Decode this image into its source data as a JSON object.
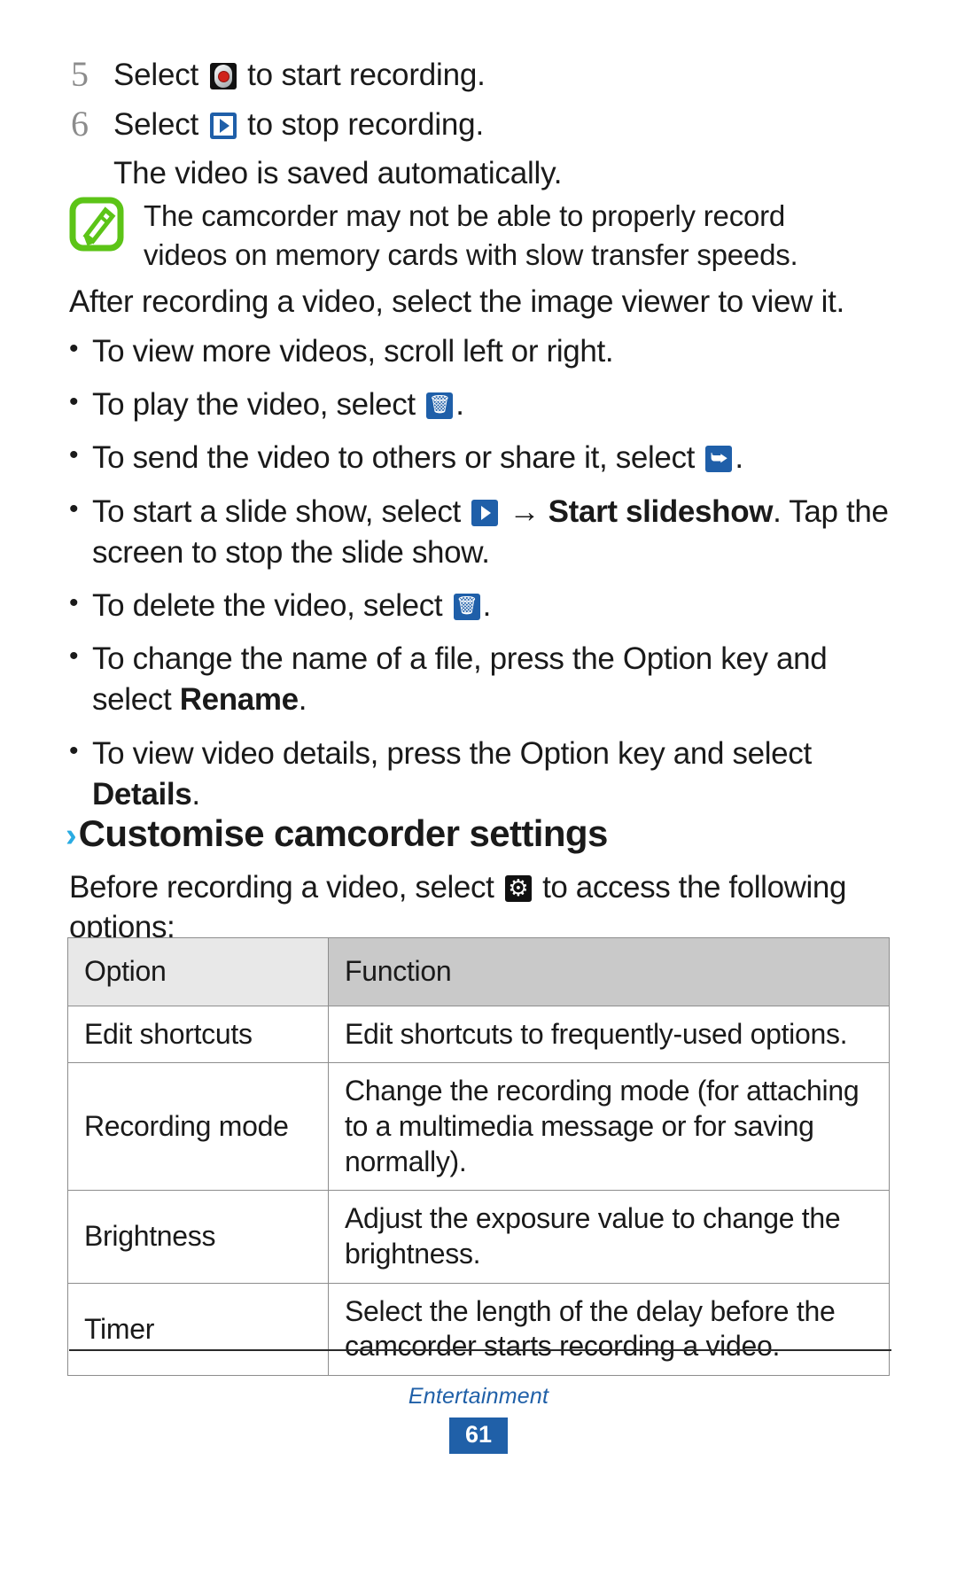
{
  "steps": [
    {
      "number": "5",
      "pre": "Select ",
      "icon": "record-icon",
      "post": " to start recording.",
      "sub": ""
    },
    {
      "number": "6",
      "pre": "Select ",
      "icon": "stop-play-icon",
      "post": " to stop recording.",
      "sub": "The video is saved automatically."
    }
  ],
  "note": {
    "icon": "note-pencil-icon",
    "text": "The camcorder may not be able to properly record videos on memory cards with slow transfer speeds."
  },
  "paragraph": "After recording a video, select the image viewer to view it.",
  "bullets": [
    {
      "dot": "•",
      "pre": "To view more videos, scroll left or right.",
      "icon": "",
      "post": "",
      "bold": "",
      "tail": ""
    },
    {
      "dot": "•",
      "pre": "To play the video, select ",
      "icon": "play-video-icon",
      "post": ".",
      "bold": "",
      "tail": ""
    },
    {
      "dot": "•",
      "pre": "To send the video to others or share it, select ",
      "icon": "share-icon",
      "post": ".",
      "bold": "",
      "tail": ""
    },
    {
      "dot": "•",
      "pre": "To start a slide show, select ",
      "icon": "slideshow-icon",
      "post": " → ",
      "bold": "Start slideshow",
      "tail": ". Tap the screen to stop the slide show."
    },
    {
      "dot": "•",
      "pre": "To delete the video, select ",
      "icon": "delete-icon",
      "post": ".",
      "bold": "",
      "tail": ""
    },
    {
      "dot": "•",
      "pre": "To change the name of a file, press the Option key and select ",
      "icon": "",
      "post": "",
      "bold": "Rename",
      "tail": "."
    },
    {
      "dot": "•",
      "pre": "To view video details, press the Option key and select ",
      "icon": "",
      "post": "",
      "bold": "Details",
      "tail": "."
    }
  ],
  "section": {
    "chevron": "›",
    "title": "Customise camcorder settings",
    "sub_pre": "Before recording a video, select ",
    "sub_icon": "gear-icon",
    "sub_post": " to access the following options:"
  },
  "table": {
    "headers": [
      "Option",
      "Function"
    ],
    "rows": [
      [
        "Edit shortcuts",
        "Edit shortcuts to frequently-used options."
      ],
      [
        "Recording mode",
        "Change the recording mode (for attaching to a multimedia message or for saving normally)."
      ],
      [
        "Brightness",
        "Adjust the exposure value to change the brightness."
      ],
      [
        "Timer",
        "Select the length of the delay before the camcorder starts recording a video."
      ]
    ]
  },
  "footer": {
    "chapter": "Entertainment",
    "page_number": "61"
  },
  "colors": {
    "accent_cyan": "#29abe2",
    "accent_blue": "#2060a8",
    "icon_blue": "#1f5fa9",
    "note_green": "#5cc417",
    "header_light": "#e8e8e8",
    "header_dark": "#c9c9c9",
    "record_red": "#d0221a"
  }
}
